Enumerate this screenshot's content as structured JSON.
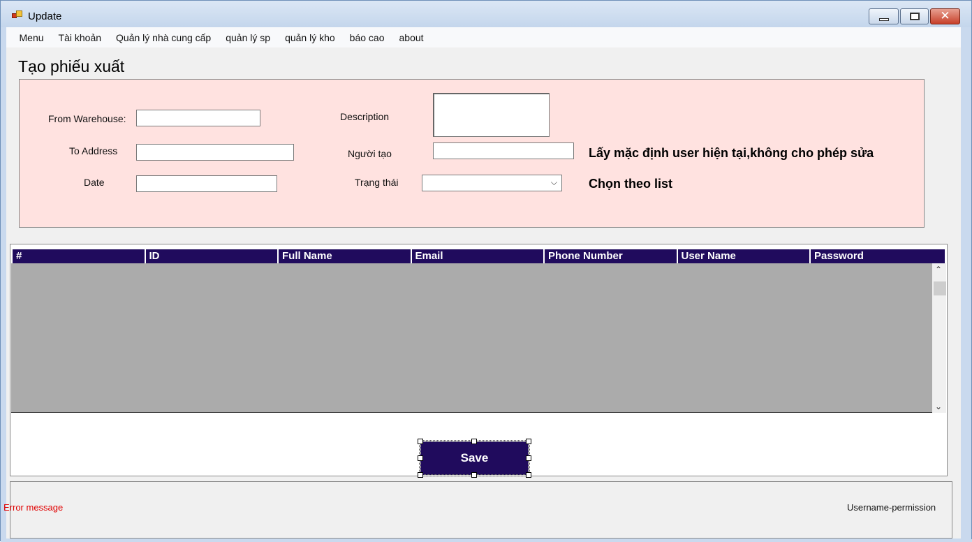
{
  "window": {
    "title": "Update"
  },
  "menu": {
    "items": [
      "Menu",
      "Tài khoản",
      "Quản lý nhà cung cấp",
      "quản lý sp",
      "quản lý kho",
      "báo cao",
      "about"
    ]
  },
  "page": {
    "title": "Tạo phiếu xuất"
  },
  "form": {
    "from_warehouse_label": "From Warehouse:",
    "from_warehouse_value": "",
    "to_address_label": "To Address",
    "to_address_value": "",
    "date_label": "Date",
    "date_value": "",
    "description_label": "Description",
    "description_value": "",
    "creator_label": "Người tạo",
    "creator_value": "",
    "status_label": "Trạng thái",
    "status_value": "",
    "creator_note": "Lấy mặc định user hiện tại,không cho phép sửa",
    "status_note": "Chọn theo list"
  },
  "grid": {
    "columns": [
      "#",
      "ID",
      "Full Name",
      "Email",
      "Phone Number",
      "User Name",
      "Password"
    ],
    "rows": []
  },
  "actions": {
    "save_label": "Save"
  },
  "status": {
    "error_message": "Error message",
    "user_permission": "Username-permission"
  },
  "colors": {
    "accent": "#200b5d",
    "form_background": "#ffe2e0",
    "grid_background": "#ababab",
    "error": "#e00000"
  }
}
